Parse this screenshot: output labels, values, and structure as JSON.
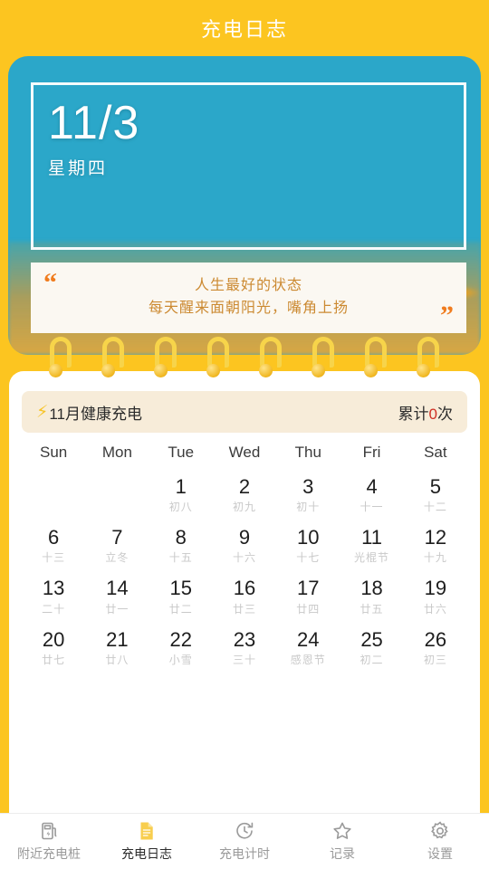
{
  "header": {
    "title": "充电日志"
  },
  "hero": {
    "date": "11/3",
    "weekday": "星期四",
    "quote_open": "“",
    "quote_close": "”",
    "quote_line1": "人生最好的状态",
    "quote_line2": "每天醒来面朝阳光，嘴角上扬",
    "photo_alt": "orange-poppies-blue-sky"
  },
  "banner": {
    "bolt": "⚡",
    "label": "11月健康充电",
    "total_prefix": "累计",
    "total_count": "0",
    "total_suffix": "次",
    "count_color": "#cf2f24"
  },
  "calendar": {
    "weekdays": [
      "Sun",
      "Mon",
      "Tue",
      "Wed",
      "Thu",
      "Fri",
      "Sat"
    ],
    "weeks": [
      [
        {
          "num": "",
          "lunar": ""
        },
        {
          "num": "",
          "lunar": ""
        },
        {
          "num": "1",
          "lunar": "初八"
        },
        {
          "num": "2",
          "lunar": "初九"
        },
        {
          "num": "3",
          "lunar": "初十"
        },
        {
          "num": "4",
          "lunar": "十一"
        },
        {
          "num": "5",
          "lunar": "十二"
        }
      ],
      [
        {
          "num": "6",
          "lunar": "十三"
        },
        {
          "num": "7",
          "lunar": "立冬"
        },
        {
          "num": "8",
          "lunar": "十五"
        },
        {
          "num": "9",
          "lunar": "十六"
        },
        {
          "num": "10",
          "lunar": "十七"
        },
        {
          "num": "11",
          "lunar": "光棍节"
        },
        {
          "num": "12",
          "lunar": "十九"
        }
      ],
      [
        {
          "num": "13",
          "lunar": "二十"
        },
        {
          "num": "14",
          "lunar": "廿一"
        },
        {
          "num": "15",
          "lunar": "廿二"
        },
        {
          "num": "16",
          "lunar": "廿三"
        },
        {
          "num": "17",
          "lunar": "廿四"
        },
        {
          "num": "18",
          "lunar": "廿五"
        },
        {
          "num": "19",
          "lunar": "廿六"
        }
      ],
      [
        {
          "num": "20",
          "lunar": "廿七"
        },
        {
          "num": "21",
          "lunar": "廿八"
        },
        {
          "num": "22",
          "lunar": "小雪"
        },
        {
          "num": "23",
          "lunar": "三十"
        },
        {
          "num": "24",
          "lunar": "感恩节"
        },
        {
          "num": "25",
          "lunar": "初二"
        },
        {
          "num": "26",
          "lunar": "初三"
        }
      ]
    ]
  },
  "nav": {
    "items": [
      {
        "label": "附近充电桩",
        "icon": "charging-pile-icon",
        "active": false
      },
      {
        "label": "充电日志",
        "icon": "document-icon",
        "active": true
      },
      {
        "label": "充电计时",
        "icon": "timer-icon",
        "active": false
      },
      {
        "label": "记录",
        "icon": "star-icon",
        "active": false
      },
      {
        "label": "设置",
        "icon": "gear-icon",
        "active": false
      }
    ]
  },
  "colors": {
    "background": "#fcc520",
    "active_accent": "#f7c325",
    "quote_text": "#cc8a32",
    "count_red": "#cf2f24"
  }
}
